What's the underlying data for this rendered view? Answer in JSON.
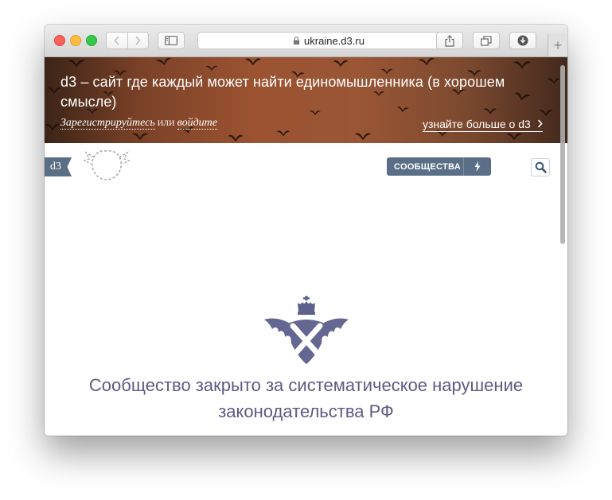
{
  "browser": {
    "url": "ukraine.d3.ru",
    "new_tab_label": "+"
  },
  "hero": {
    "title": "d3 – сайт где каждый может найти единомышленника (в хорошем смысле)",
    "register_link": "Зарегистрируйтесь",
    "or_text": "или",
    "login_link": "войдите",
    "learn_more": "узнайте больше о d3"
  },
  "site": {
    "logo_text": "d3",
    "communities_label": "СООБЩЕСТВА"
  },
  "main": {
    "closed_message": "Сообщество закрыто за систематическое нарушение законодательства РФ"
  },
  "colors": {
    "accent": "#5a6e87",
    "message": "#5d5a85"
  }
}
